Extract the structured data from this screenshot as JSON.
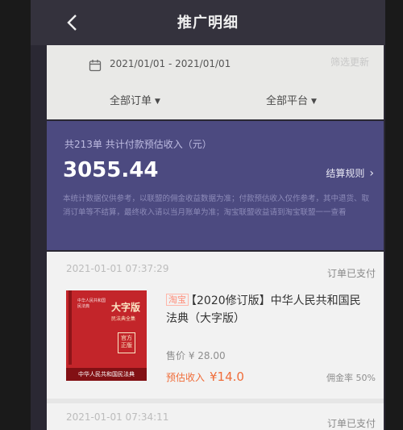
{
  "nav": {
    "title": "推广明细",
    "back_icon": "chevron-left-icon"
  },
  "filter": {
    "date_range": "2021/01/01 - 2021/01/01",
    "link": "筛选更新",
    "order_filter": "全部订单",
    "platform_filter": "全部平台"
  },
  "summary": {
    "label": "共213单 共计付款预估收入（元）",
    "amount": "3055.44",
    "rules_link": "结算规则",
    "note": "本统计数据仅供参考，以联盟的佣金收益数据为准；付款预估收入仅作参考，其中退货、取消订单等不结算，最终收入请以当月账单为准；淘宝联盟收益请到淘宝联盟一一查看"
  },
  "orders": [
    {
      "time": "2021-01-01 07:37:29",
      "status": "订单已支付",
      "tag": "淘宝",
      "title": "【2020修订版】中华人民共和国民法典（大字版）",
      "price": "售价 ¥ 28.00",
      "income_label": "预估收入",
      "income_value": "¥14.0",
      "rate": "佣金率 50%",
      "cover": {
        "big": "大字版",
        "small": "民法典全集",
        "seal": "官方正版",
        "band": "中华人民共和国民法典",
        "cn": "中华人民共和国民法典"
      }
    },
    {
      "time": "2021-01-01 07:34:11",
      "status": "订单已支付"
    }
  ],
  "colors": {
    "accent_purple": "#4c4a80",
    "income_orange": "#f06d3a"
  }
}
